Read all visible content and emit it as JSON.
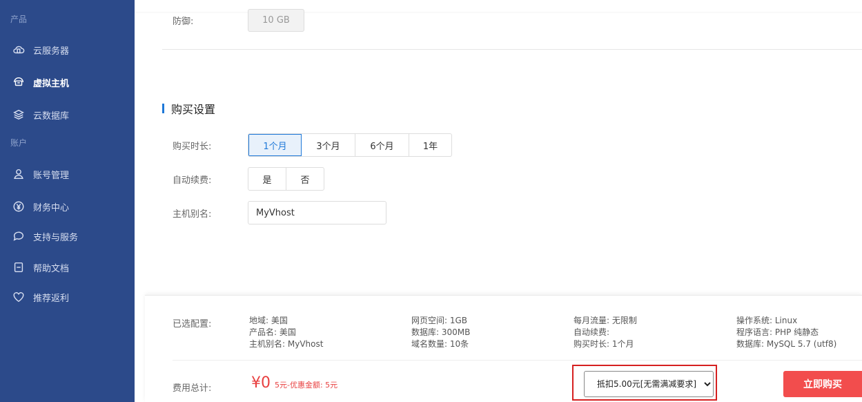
{
  "sidebar": {
    "section_product": "产品",
    "section_account": "账户",
    "items": [
      {
        "label": "云服务器",
        "icon": "cloud-server-icon"
      },
      {
        "label": "虚拟主机",
        "icon": "virtual-host-icon",
        "active": true
      },
      {
        "label": "云数据库",
        "icon": "database-layers-icon"
      },
      {
        "label": "账号管理",
        "icon": "user-icon"
      },
      {
        "label": "财务中心",
        "icon": "yen-circle-icon"
      },
      {
        "label": "支持与服务",
        "icon": "chat-bubble-icon"
      },
      {
        "label": "帮助文档",
        "icon": "document-icon"
      },
      {
        "label": "推荐返利",
        "icon": "heart-icon"
      }
    ]
  },
  "defense": {
    "label": "防御:",
    "value": "10 GB"
  },
  "purchase": {
    "title": "购买设置",
    "duration_label": "购买时长:",
    "durations": [
      "1个月",
      "3个月",
      "6个月",
      "1年"
    ],
    "auto_renew_label": "自动续费:",
    "auto_renew_options": [
      "是",
      "否"
    ],
    "alias_label": "主机别名:",
    "alias_value": "MyVhost"
  },
  "summary": {
    "selected_label": "已选配置:",
    "col1": [
      "地域: 美国",
      "产品名: 美国",
      "主机别名: MyVhost"
    ],
    "col2": [
      "网页空间: 1GB",
      "数据库: 300MB",
      "域名数量: 10条"
    ],
    "col3": [
      "每月流量: 无限制",
      "自动续费:",
      "购买时长: 1个月"
    ],
    "col4": [
      "操作系统: Linux",
      "程序语言: PHP 纯静态",
      "数据库: MySQL 5.7 (utf8)"
    ],
    "total_label": "费用总计:",
    "currency": "¥",
    "price": "0",
    "price_detail": "5元-优惠金额: 5元",
    "coupon_selected": "抵扣5.00元[无需满减要求]",
    "buy_label": "立即购买"
  },
  "colors": {
    "sidebar_bg": "#2c4a8a",
    "accent": "#1e78d8",
    "price": "#e84040",
    "buy_button": "#f24d4d",
    "highlight_frame": "#d62020"
  }
}
